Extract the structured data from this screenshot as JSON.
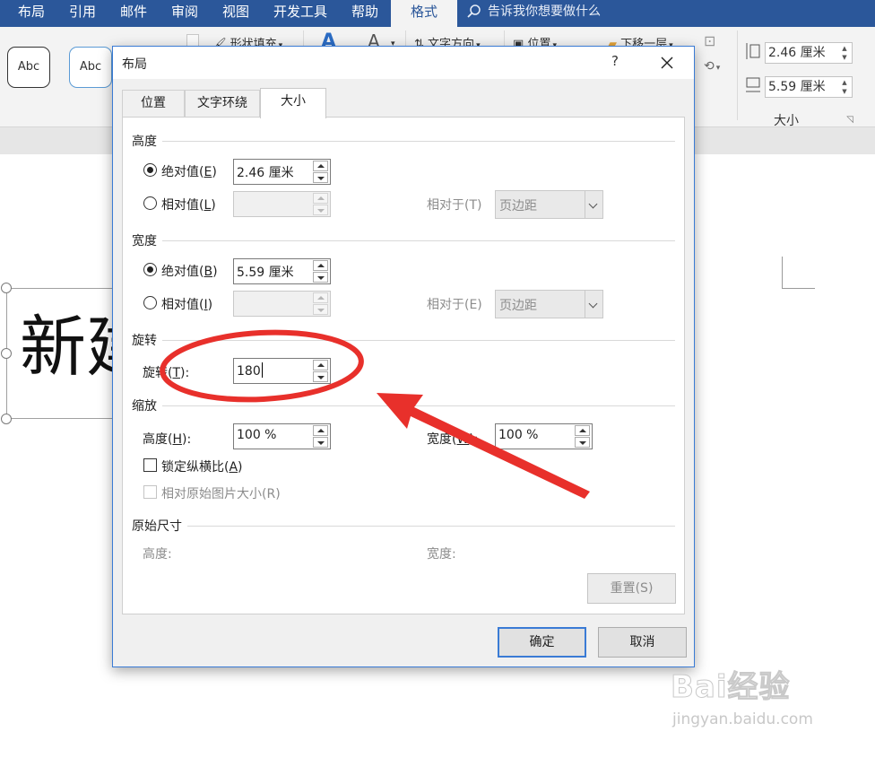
{
  "ribbon": {
    "tabs": [
      {
        "label": "布局"
      },
      {
        "label": "引用"
      },
      {
        "label": "邮件"
      },
      {
        "label": "审阅"
      },
      {
        "label": "视图"
      },
      {
        "label": "开发工具"
      },
      {
        "label": "帮助"
      },
      {
        "label": "格式"
      }
    ],
    "active_tab": "格式",
    "tell_me": "告诉我你想要做什么",
    "shape_styles": [
      "Abc",
      "Abc"
    ],
    "buttons": {
      "shape_fill": "形状填充",
      "text_direction": "文字方向",
      "position": "位置",
      "send_backward": "下移一层"
    },
    "size": {
      "height": "2.46 厘米",
      "width": "5.59 厘米",
      "group_label": "大小"
    }
  },
  "document": {
    "text": "新建"
  },
  "dialog": {
    "title": "布局",
    "help": "?",
    "tabs": [
      {
        "label": "位置"
      },
      {
        "label": "文字环绕"
      },
      {
        "label": "大小"
      }
    ],
    "active_tab": "大小",
    "height": {
      "section": "高度",
      "absolute_label": "绝对值(",
      "absolute_key": "E",
      "absolute_value": "2.46 厘米",
      "relative_label": "相对值(",
      "relative_key": "L",
      "relative_to_label": "相对于(T)",
      "relative_to_value": "页边距"
    },
    "width": {
      "section": "宽度",
      "absolute_label": "绝对值(",
      "absolute_key": "B",
      "absolute_value": "5.59 厘米",
      "relative_label": "相对值(",
      "relative_key": "I",
      "relative_to_label": "相对于(E)",
      "relative_to_value": "页边距"
    },
    "rotation": {
      "section": "旋转",
      "label": "旋转(",
      "key": "T",
      "value": "180"
    },
    "scale": {
      "section": "缩放",
      "height_label": "高度(",
      "height_key": "H",
      "height_value": "100 %",
      "width_label": "宽度(",
      "width_key": "W",
      "width_value": "100 %",
      "lock_label": "锁定纵横比(",
      "lock_key": "A",
      "relative_original_label": "相对原始图片大小(R)"
    },
    "original": {
      "section": "原始尺寸",
      "height_label": "高度:",
      "width_label": "宽度:"
    },
    "reset_label": "重置(S)",
    "ok_label": "确定",
    "cancel_label": "取消"
  },
  "watermark": {
    "brand": "Bai经验",
    "url": "jingyan.baidu.com"
  },
  "colors": {
    "ribbon_blue": "#2b579a",
    "annotation_red": "#e8302b",
    "focus_blue": "#3a7bd5"
  }
}
